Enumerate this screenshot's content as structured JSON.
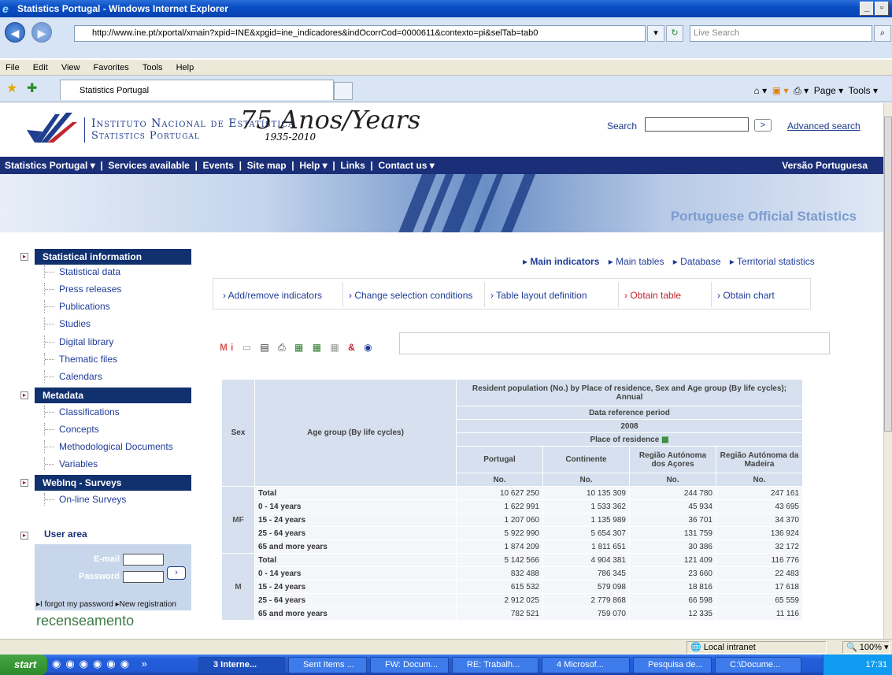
{
  "window": {
    "title": "Statistics Portugal - Windows Internet Explorer"
  },
  "address": {
    "url": "http://www.ine.pt/xportal/xmain?xpid=INE&xpgid=ine_indicadores&indOcorrCod=0000611&contexto=pi&selTab=tab0",
    "search_placeholder": "Live Search"
  },
  "menu": [
    "File",
    "Edit",
    "View",
    "Favorites",
    "Tools",
    "Help"
  ],
  "tab": {
    "label": "Statistics Portugal"
  },
  "tools": {
    "page": "Page ▾",
    "tools": "Tools ▾"
  },
  "header": {
    "line1": "Instituto Nacional de Estatística",
    "line2": "Statistics Portugal",
    "anos": "75 Anos/Years",
    "years": "1935-2010",
    "search_label": "Search",
    "search_btn": ">",
    "advanced": "Advanced search"
  },
  "nav": {
    "items": [
      "Statistics Portugal ▾",
      "Services available",
      "Events",
      "Site map",
      "Help ▾",
      "Links",
      "Contact us ▾"
    ],
    "versao": "Versão Portuguesa"
  },
  "banner": {
    "text": "Portuguese Official Statistics"
  },
  "sidebar": {
    "statinfo": {
      "title": "Statistical information",
      "items": [
        "Statistical data",
        "Press releases",
        "Publications",
        "Studies",
        "Digital library",
        "Thematic files",
        "Calendars"
      ]
    },
    "metadata": {
      "title": "Metadata",
      "items": [
        "Classifications",
        "Concepts",
        "Methodological Documents",
        "Variables"
      ]
    },
    "webinq": {
      "title": "WebInq - Surveys",
      "items": [
        "On-line Surveys"
      ]
    },
    "user": {
      "title": "User area",
      "email": "E-mail",
      "password": "Password",
      "forgot": "▸I forgot my password ▸New registration",
      "recens": "recenseamento"
    }
  },
  "toptabs": [
    "Main indicators",
    "Main tables",
    "Database",
    "Territorial statistics"
  ],
  "toolbox": [
    "› Add/remove indicators",
    "› Change selection conditions",
    "› Table layout definition",
    "› Obtain table",
    "› Obtain chart"
  ],
  "colors": {
    "navy": "#1a2f78",
    "obtain_table": "#c0262d"
  },
  "table": {
    "title": "Resident population (No.) by Place of residence, Sex and Age group (By life cycles); Annual",
    "sex_header": "Sex",
    "age_header": "Age group (By life cycles)",
    "ref_period": "Data reference period",
    "year": "2008",
    "place": "Place of residence",
    "cols": [
      "Portugal",
      "Continente",
      "Região Autónoma dos Açores",
      "Região Autónoma da Madeira"
    ],
    "unit": "No.",
    "groups": [
      {
        "sex": "MF",
        "rows": [
          [
            "Total",
            "10 627 250",
            "10 135 309",
            "244 780",
            "247 161"
          ],
          [
            "0 - 14 years",
            "1 622 991",
            "1 533 362",
            "45 934",
            "43 695"
          ],
          [
            "15 - 24 years",
            "1 207 060",
            "1 135 989",
            "36 701",
            "34 370"
          ],
          [
            "25 - 64 years",
            "5 922 990",
            "5 654 307",
            "131 759",
            "136 924"
          ],
          [
            "65 and more years",
            "1 874 209",
            "1 811 651",
            "30 386",
            "32 172"
          ]
        ]
      },
      {
        "sex": "M",
        "rows": [
          [
            "Total",
            "5 142 566",
            "4 904 381",
            "121 409",
            "116 776"
          ],
          [
            "0 - 14 years",
            "832 488",
            "786 345",
            "23 660",
            "22 483"
          ],
          [
            "15 - 24 years",
            "615 532",
            "579 098",
            "18 816",
            "17 618"
          ],
          [
            "25 - 64 years",
            "2 912 025",
            "2 779 868",
            "66 598",
            "65 559"
          ],
          [
            "65 and more years",
            "782 521",
            "759 070",
            "12 335",
            "11 116"
          ]
        ]
      }
    ]
  },
  "status": {
    "zone": "Local intranet",
    "zoom": "100%"
  },
  "taskbar": {
    "start": "start",
    "items": [
      "3 Interne...",
      "Sent Items ...",
      "FW: Docum...",
      "RE: Trabalh...",
      "4 Microsof...",
      "Pesquisa de...",
      "C:\\Docume..."
    ],
    "clock": "17:31"
  }
}
